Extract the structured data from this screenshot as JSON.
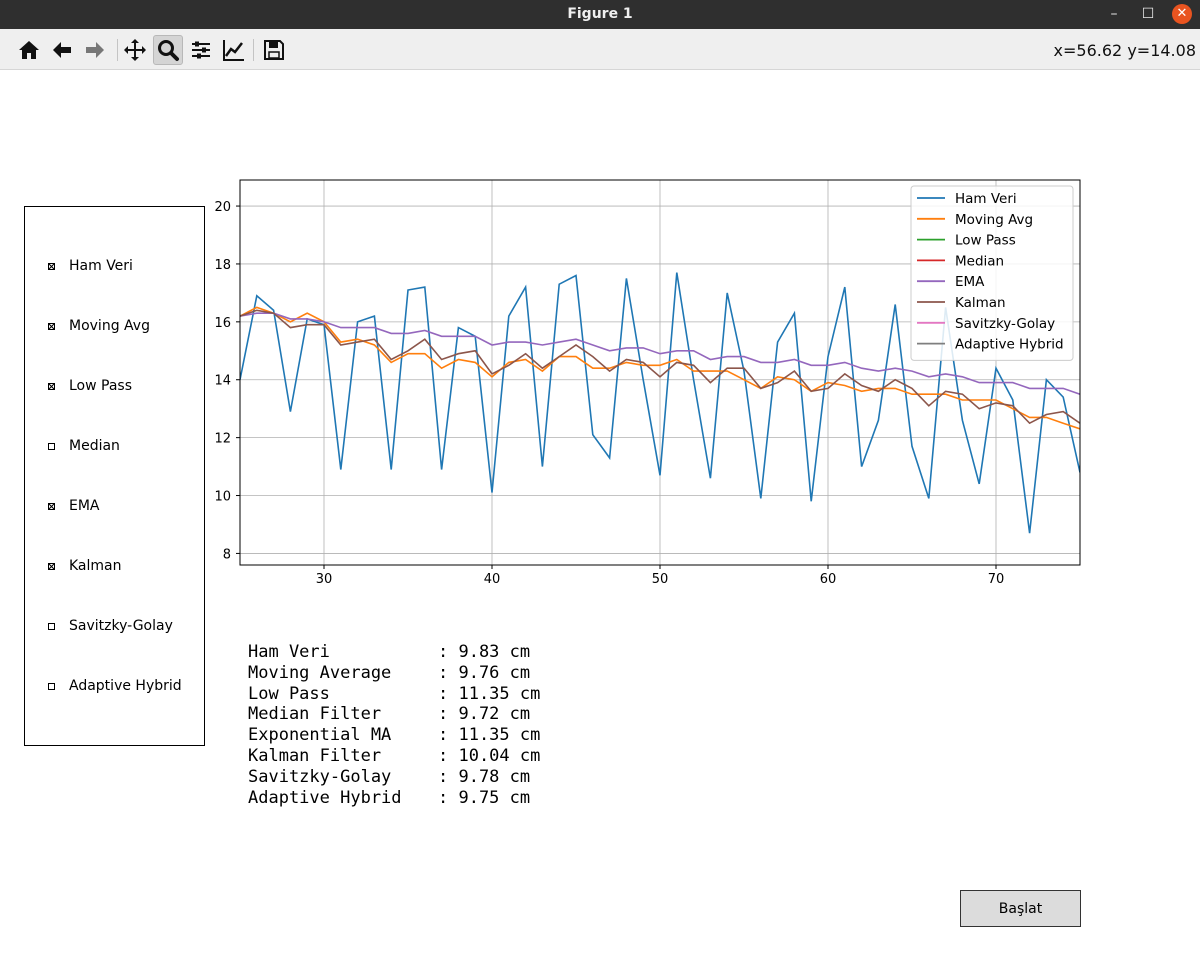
{
  "window": {
    "title": "Figure 1",
    "min_glyph": "–",
    "max_glyph": "☐",
    "close_glyph": "✕"
  },
  "toolbar": {
    "buttons": [
      {
        "name": "home-icon",
        "tooltip": "Home"
      },
      {
        "name": "back-icon",
        "tooltip": "Back"
      },
      {
        "name": "forward-icon",
        "tooltip": "Forward"
      },
      {
        "name": "pan-icon",
        "tooltip": "Pan"
      },
      {
        "name": "zoom-icon",
        "tooltip": "Zoom",
        "active": true
      },
      {
        "name": "subplots-icon",
        "tooltip": "Subplots"
      },
      {
        "name": "customize-icon",
        "tooltip": "Customize"
      },
      {
        "name": "save-icon",
        "tooltip": "Save"
      }
    ],
    "coords": "x=56.62 y=14.08"
  },
  "checkboxes": [
    {
      "label": "Ham Veri",
      "checked": true
    },
    {
      "label": "Moving Avg",
      "checked": true
    },
    {
      "label": "Low Pass",
      "checked": true
    },
    {
      "label": "Median",
      "checked": false
    },
    {
      "label": "EMA",
      "checked": true
    },
    {
      "label": "Kalman",
      "checked": true
    },
    {
      "label": "Savitzky-Golay",
      "checked": false
    },
    {
      "label": "Adaptive Hybrid",
      "checked": false
    }
  ],
  "chart_data": {
    "type": "line",
    "xlim": [
      25,
      75
    ],
    "ylim": [
      7.6,
      20.9
    ],
    "xticks": [
      30,
      40,
      50,
      60,
      70
    ],
    "yticks": [
      8,
      10,
      12,
      14,
      16,
      18,
      20
    ],
    "grid": true,
    "legend_position": "top-right",
    "x_start": 25,
    "series": [
      {
        "name": "Ham Veri",
        "color": "#1f77b4",
        "visible": true,
        "values": [
          14.0,
          16.9,
          16.4,
          12.9,
          16.1,
          15.9,
          10.9,
          16.0,
          16.2,
          10.9,
          17.1,
          17.2,
          10.9,
          15.8,
          15.5,
          10.1,
          16.2,
          17.2,
          11.0,
          17.3,
          17.6,
          12.1,
          11.3,
          17.5,
          14.0,
          10.7,
          17.7,
          14.0,
          10.6,
          17.0,
          14.3,
          9.9,
          15.3,
          16.3,
          9.8,
          14.8,
          17.2,
          11.0,
          12.6,
          16.6,
          11.7,
          9.9,
          16.5,
          12.6,
          10.4,
          14.4,
          13.3,
          8.7,
          14.0,
          13.4,
          10.8
        ]
      },
      {
        "name": "Moving Avg",
        "color": "#ff7f0e",
        "visible": true,
        "values": [
          16.2,
          16.5,
          16.3,
          16.0,
          16.3,
          16.0,
          15.3,
          15.4,
          15.2,
          14.6,
          14.9,
          14.9,
          14.4,
          14.7,
          14.6,
          14.1,
          14.6,
          14.7,
          14.3,
          14.8,
          14.8,
          14.4,
          14.4,
          14.6,
          14.5,
          14.5,
          14.7,
          14.3,
          14.3,
          14.3,
          14.0,
          13.7,
          14.1,
          14.0,
          13.6,
          13.9,
          13.8,
          13.6,
          13.7,
          13.7,
          13.5,
          13.5,
          13.5,
          13.3,
          13.3,
          13.3,
          13.0,
          12.7,
          12.7,
          12.5,
          12.3
        ]
      },
      {
        "name": "Low Pass",
        "color": "#2ca02c",
        "visible": false,
        "values": []
      },
      {
        "name": "Median",
        "color": "#d62728",
        "visible": false,
        "values": []
      },
      {
        "name": "EMA",
        "color": "#9467bd",
        "visible": true,
        "values": [
          16.2,
          16.3,
          16.3,
          16.1,
          16.1,
          16.0,
          15.8,
          15.8,
          15.8,
          15.6,
          15.6,
          15.7,
          15.5,
          15.5,
          15.5,
          15.2,
          15.3,
          15.3,
          15.2,
          15.3,
          15.4,
          15.2,
          15.0,
          15.1,
          15.1,
          14.9,
          15.0,
          15.0,
          14.7,
          14.8,
          14.8,
          14.6,
          14.6,
          14.7,
          14.5,
          14.5,
          14.6,
          14.4,
          14.3,
          14.4,
          14.3,
          14.1,
          14.2,
          14.1,
          13.9,
          13.9,
          13.9,
          13.7,
          13.7,
          13.7,
          13.5
        ]
      },
      {
        "name": "Kalman",
        "color": "#8c564b",
        "visible": true,
        "values": [
          16.2,
          16.4,
          16.3,
          15.8,
          15.9,
          15.9,
          15.2,
          15.3,
          15.4,
          14.7,
          15.0,
          15.4,
          14.7,
          14.9,
          15.0,
          14.2,
          14.5,
          14.9,
          14.4,
          14.8,
          15.2,
          14.8,
          14.3,
          14.7,
          14.6,
          14.1,
          14.6,
          14.5,
          13.9,
          14.4,
          14.4,
          13.7,
          13.9,
          14.3,
          13.6,
          13.7,
          14.2,
          13.8,
          13.6,
          14.0,
          13.7,
          13.1,
          13.6,
          13.5,
          13.0,
          13.2,
          13.1,
          12.5,
          12.8,
          12.9,
          12.5
        ]
      },
      {
        "name": "Savitzky-Golay",
        "color": "#e377c2",
        "visible": false,
        "values": []
      },
      {
        "name": "Adaptive Hybrid",
        "color": "#7f7f7f",
        "visible": false,
        "values": []
      }
    ]
  },
  "stats": [
    {
      "name": "Ham Veri",
      "value": ": 9.83 cm"
    },
    {
      "name": "Moving Average",
      "value": ": 9.76 cm"
    },
    {
      "name": "Low Pass",
      "value": ": 11.35 cm"
    },
    {
      "name": "Median Filter",
      "value": ": 9.72 cm"
    },
    {
      "name": "Exponential MA",
      "value": ": 11.35 cm"
    },
    {
      "name": "Kalman Filter",
      "value": ": 10.04 cm"
    },
    {
      "name": "Savitzky-Golay",
      "value": ": 9.78 cm"
    },
    {
      "name": "Adaptive Hybrid",
      "value": ": 9.75 cm"
    }
  ],
  "start_button": "Başlat"
}
